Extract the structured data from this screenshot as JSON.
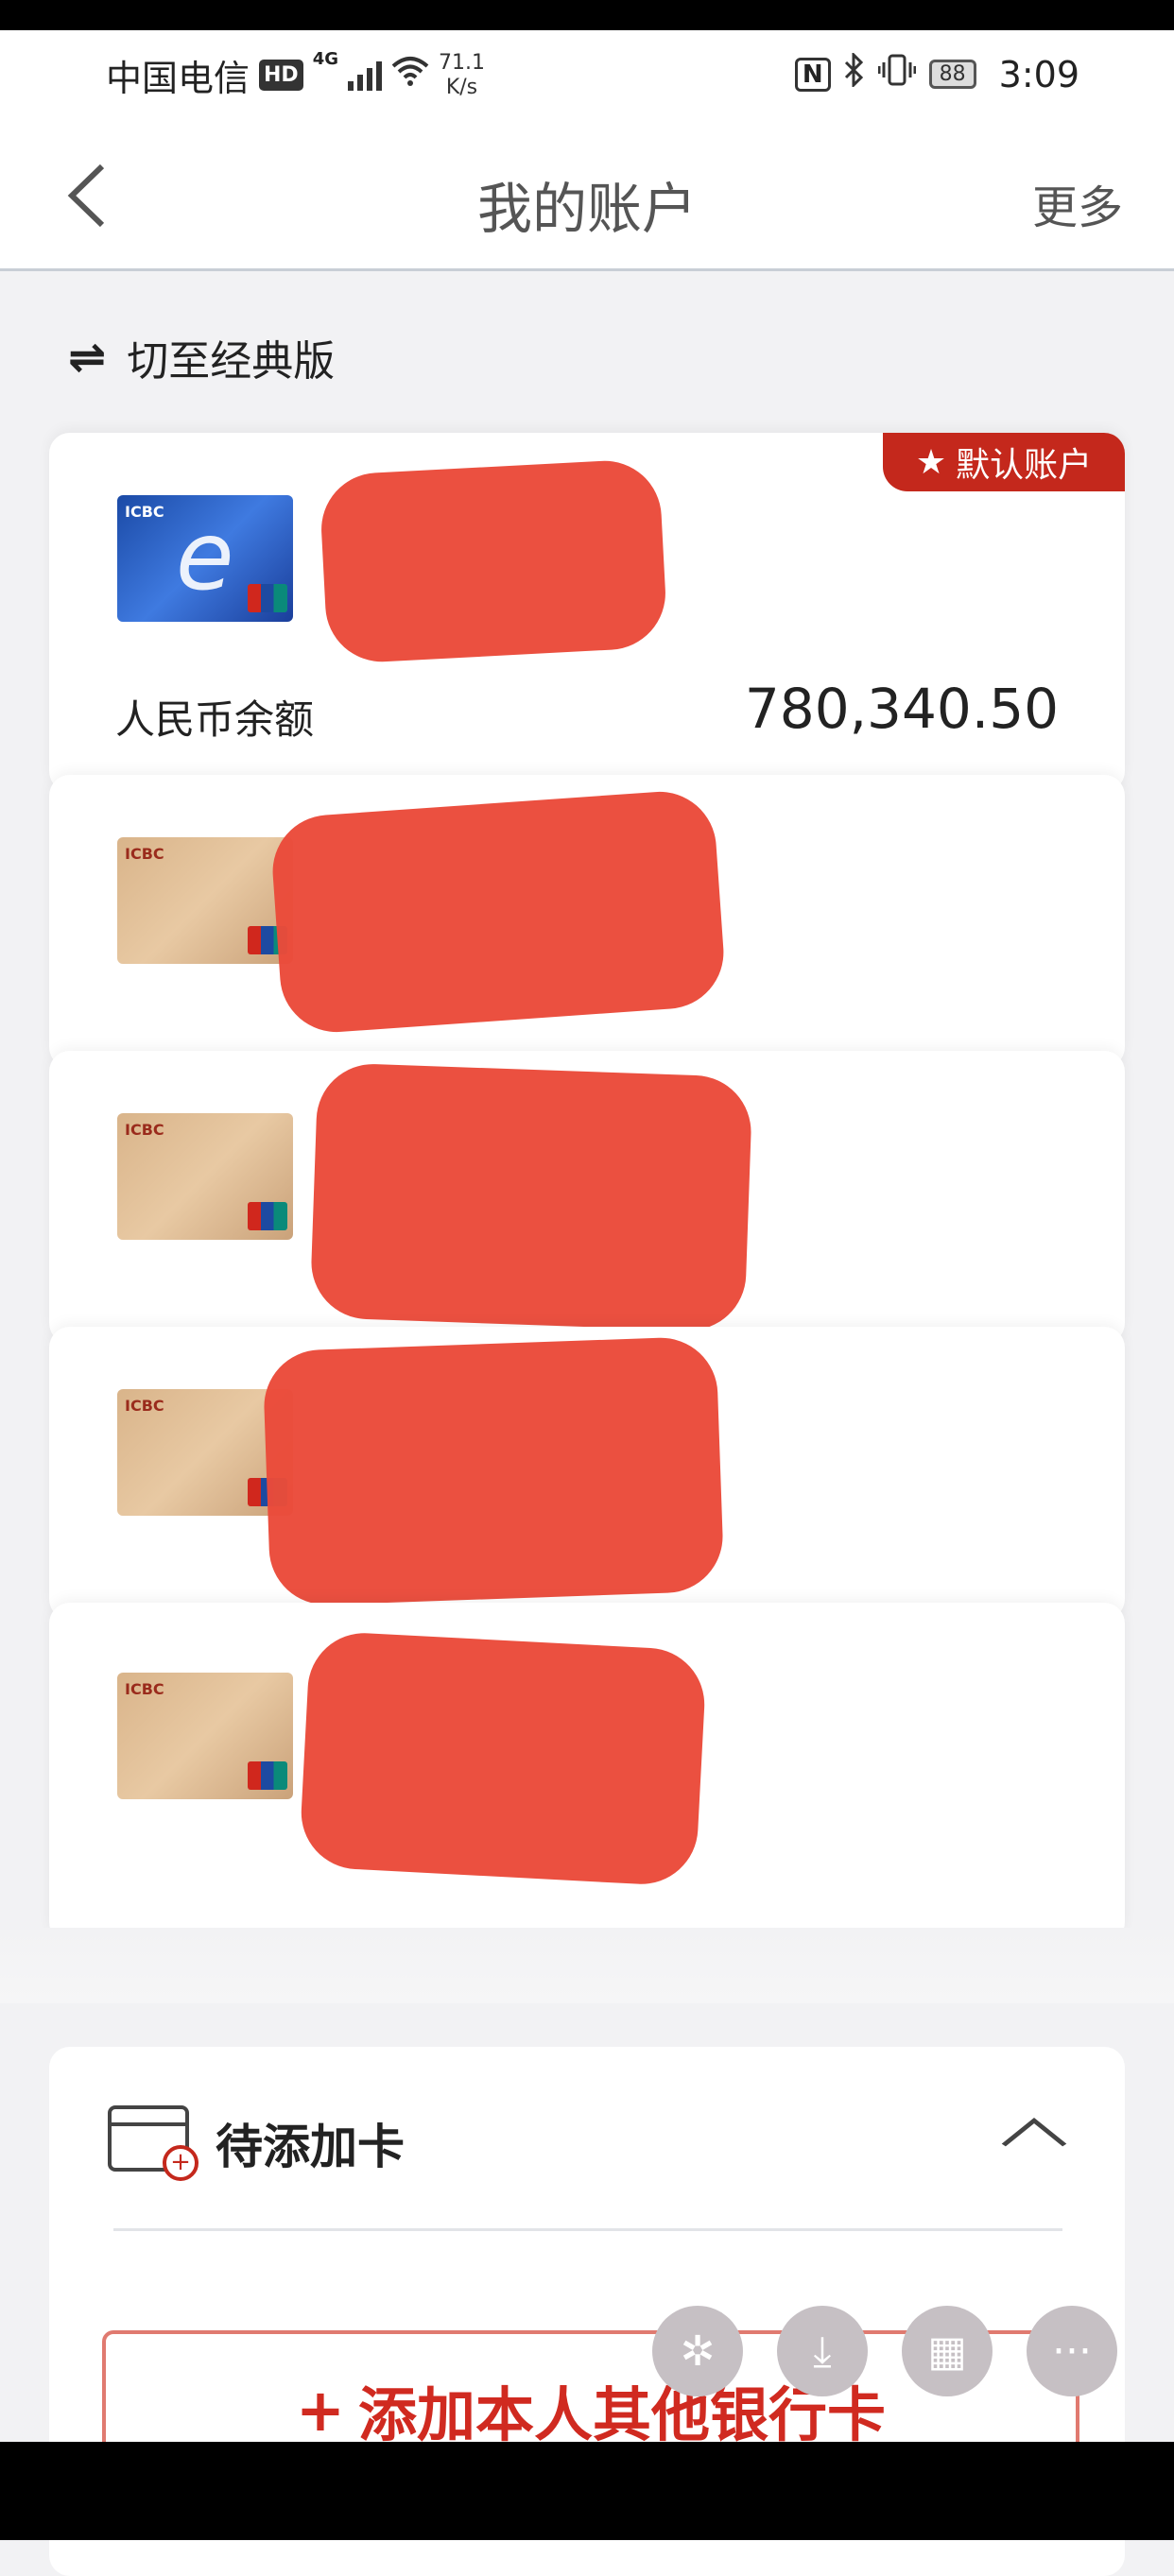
{
  "status": {
    "carrier": "中国电信",
    "hd": "HD",
    "signal": "4G",
    "speed_value": "71.1",
    "speed_unit": "K/s",
    "nfc": "N",
    "battery": "88",
    "time": "3:09"
  },
  "nav": {
    "back": "<",
    "title": "我的账户",
    "more": "更多"
  },
  "switch": {
    "icon": "⇌",
    "label": "切至经典版"
  },
  "default_card": {
    "badge_icon": "★",
    "badge_label": "默认账户",
    "balance_label": "人民币余额",
    "balance_value": "780,340.50"
  },
  "card_logo": "ICBC",
  "pending": {
    "title": "待添加卡",
    "add_icon": "+",
    "add_label": "添加本人其他银行卡"
  },
  "fab": {
    "icon_1": "✲",
    "icon_2": "⤓",
    "icon_3": "▦",
    "icon_4": "···"
  },
  "colors": {
    "accent": "#c4281c",
    "redaction": "#ea4a3a"
  }
}
